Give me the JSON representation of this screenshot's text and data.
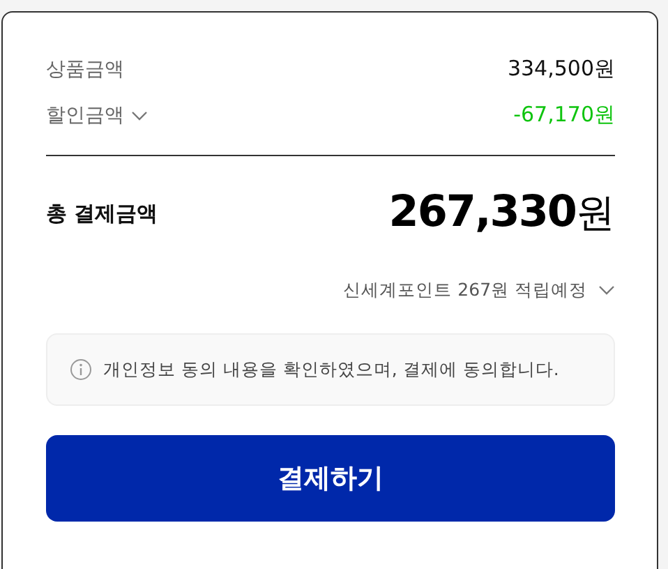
{
  "summary_rows": [
    {
      "label": "상품금액",
      "value": "334,500원",
      "kind": "regular"
    },
    {
      "label": "할인금액",
      "value": "-67,170원",
      "kind": "discount"
    }
  ],
  "total": {
    "label": "총 결제금액",
    "amount": "267,330",
    "unit": "원"
  },
  "points_note": "신세계포인트 267원 적립예정",
  "consent_notice": "개인정보 동의 내용을 확인하였으며, 결제에 동의합니다.",
  "pay_button": "결제하기"
}
